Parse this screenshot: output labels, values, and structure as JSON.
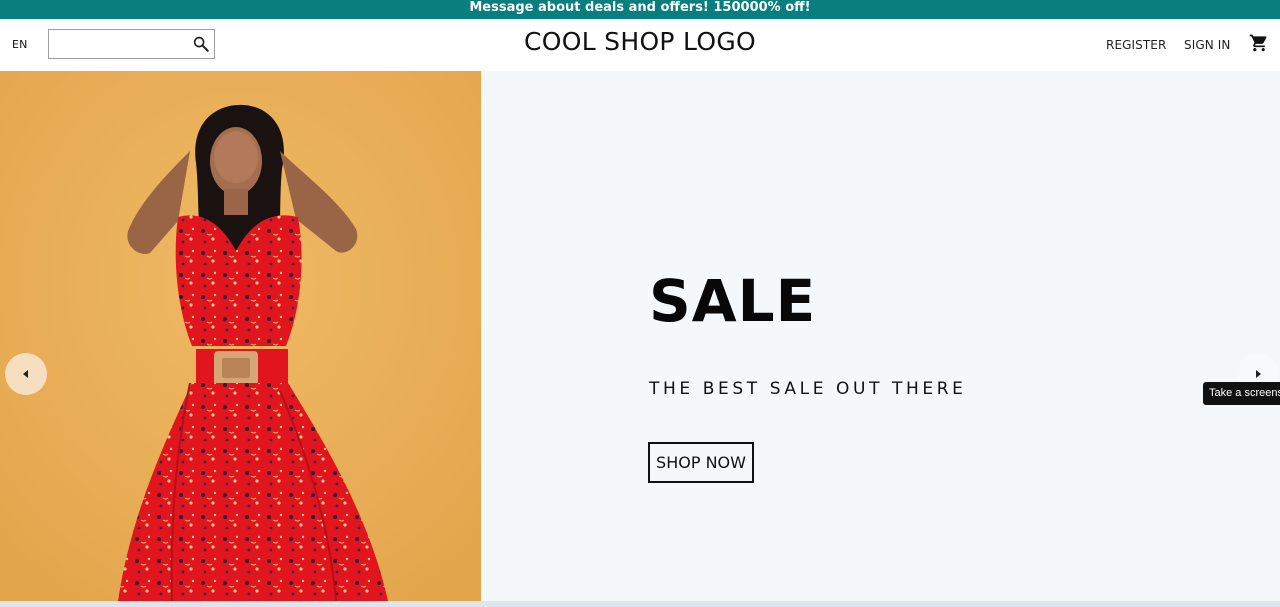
{
  "announcement": {
    "text": "Message about deals and offers! 150000% off!"
  },
  "header": {
    "language": "EN",
    "search": {
      "value": "",
      "placeholder": ""
    },
    "logo": "COOL SHOP LOGO",
    "register_label": "REGISTER",
    "signin_label": "SIGN IN"
  },
  "hero": {
    "title": "SALE",
    "subtitle": "THE BEST SALE OUT THERE",
    "button_label": "SHOP NOW"
  },
  "tooltip": {
    "text": "Take a screenshot"
  },
  "colors": {
    "announcement_bg": "#087e7e",
    "hero_image_bg": "#e9ae52",
    "hero_bg": "#f4f8fb",
    "dress": "#e0151d"
  },
  "icons": {
    "search": "search-icon",
    "cart": "cart-icon",
    "prev": "chevron-left-icon",
    "next": "chevron-right-icon"
  }
}
